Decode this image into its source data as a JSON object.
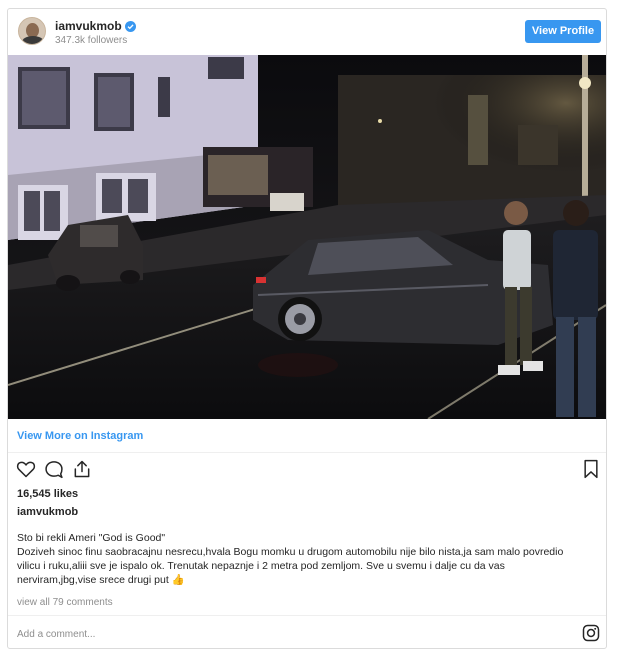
{
  "header": {
    "username": "iamvukmob",
    "followers": "347.3k followers",
    "view_profile_label": "View Profile"
  },
  "post": {
    "view_more_label": "View More on Instagram",
    "likes": "16,545 likes",
    "owner": "iamvukmob",
    "caption_lines": [
      "Sto bi rekli Ameri \"God is Good\"",
      "Doziveh sinoc finu saobracajnu nesrecu,hvala Bogu momku u drugom automobilu nije bilo nista,ja sam malo povredio vilicu i ruku,aliii sve je ispalo ok. Trenutak nepaznje i 2 metra pod zemljom. Sve u svemu i dalje cu da vas nerviram,jbg,vise srece drugi put 👍"
    ],
    "view_comments": "view all 79 comments",
    "add_comment_placeholder": "Add a comment..."
  },
  "icons": [
    "verified-badge-icon",
    "heart-icon",
    "comment-icon",
    "share-icon",
    "bookmark-icon",
    "instagram-logo-icon"
  ],
  "colors": {
    "accent": "#3897f0",
    "muted": "#8e8e8e",
    "text": "#262626"
  }
}
